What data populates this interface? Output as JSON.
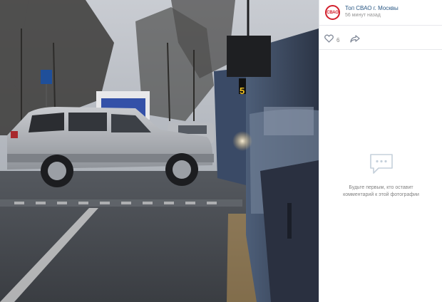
{
  "post": {
    "author": "Топ СВАО г. Москвы",
    "avatar_text": "СВАО",
    "time": "56 минут назад",
    "likes": "6",
    "empty_comments_line1": "Будьте первым, кто оставит",
    "empty_comments_line2": "комментарий к этой фотографии"
  },
  "photo": {
    "bus_route_number": "5"
  },
  "icons": {
    "like": "heart-icon",
    "share": "share-arrow-icon",
    "comments": "comment-bubble-icon"
  },
  "colors": {
    "link": "#2a5885",
    "muted": "#828282",
    "avatar_red": "#d21f2c"
  }
}
